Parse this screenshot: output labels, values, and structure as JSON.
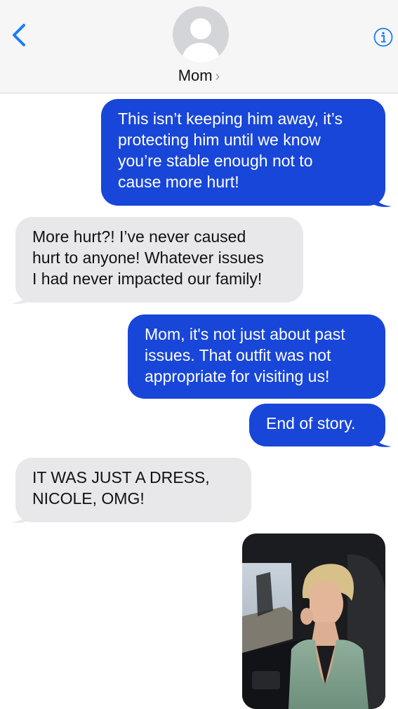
{
  "header": {
    "contact_name": "Mom",
    "chevron": "›",
    "back_icon": "chevron-left-icon",
    "info_icon": "info-icon"
  },
  "messages": [
    {
      "from": "me",
      "text": "This isn’t keeping him away, it’s\nprotecting him until we know\nyou’re stable enough not to\ncause more hurt!"
    },
    {
      "from": "mom",
      "text": "More hurt?! I’ve never caused\nhurt to anyone! Whatever issues\nI had never impacted our family!"
    },
    {
      "from": "me",
      "text": "Mom, it's not just about past\nissues. That outfit was not\nappropriate for visiting us!"
    },
    {
      "from": "me",
      "text": "End of story."
    },
    {
      "from": "mom",
      "text": "IT WAS JUST A DRESS,\nNICOLE, OMG!"
    }
  ],
  "photo": {
    "from": "me",
    "kind": "image",
    "description_icon": "photo-attachment"
  },
  "colors": {
    "outgoing": "#1846d8",
    "incoming": "#e8e8ea",
    "accent": "#1c7cf6",
    "header_bg": "#f6f6f7"
  }
}
